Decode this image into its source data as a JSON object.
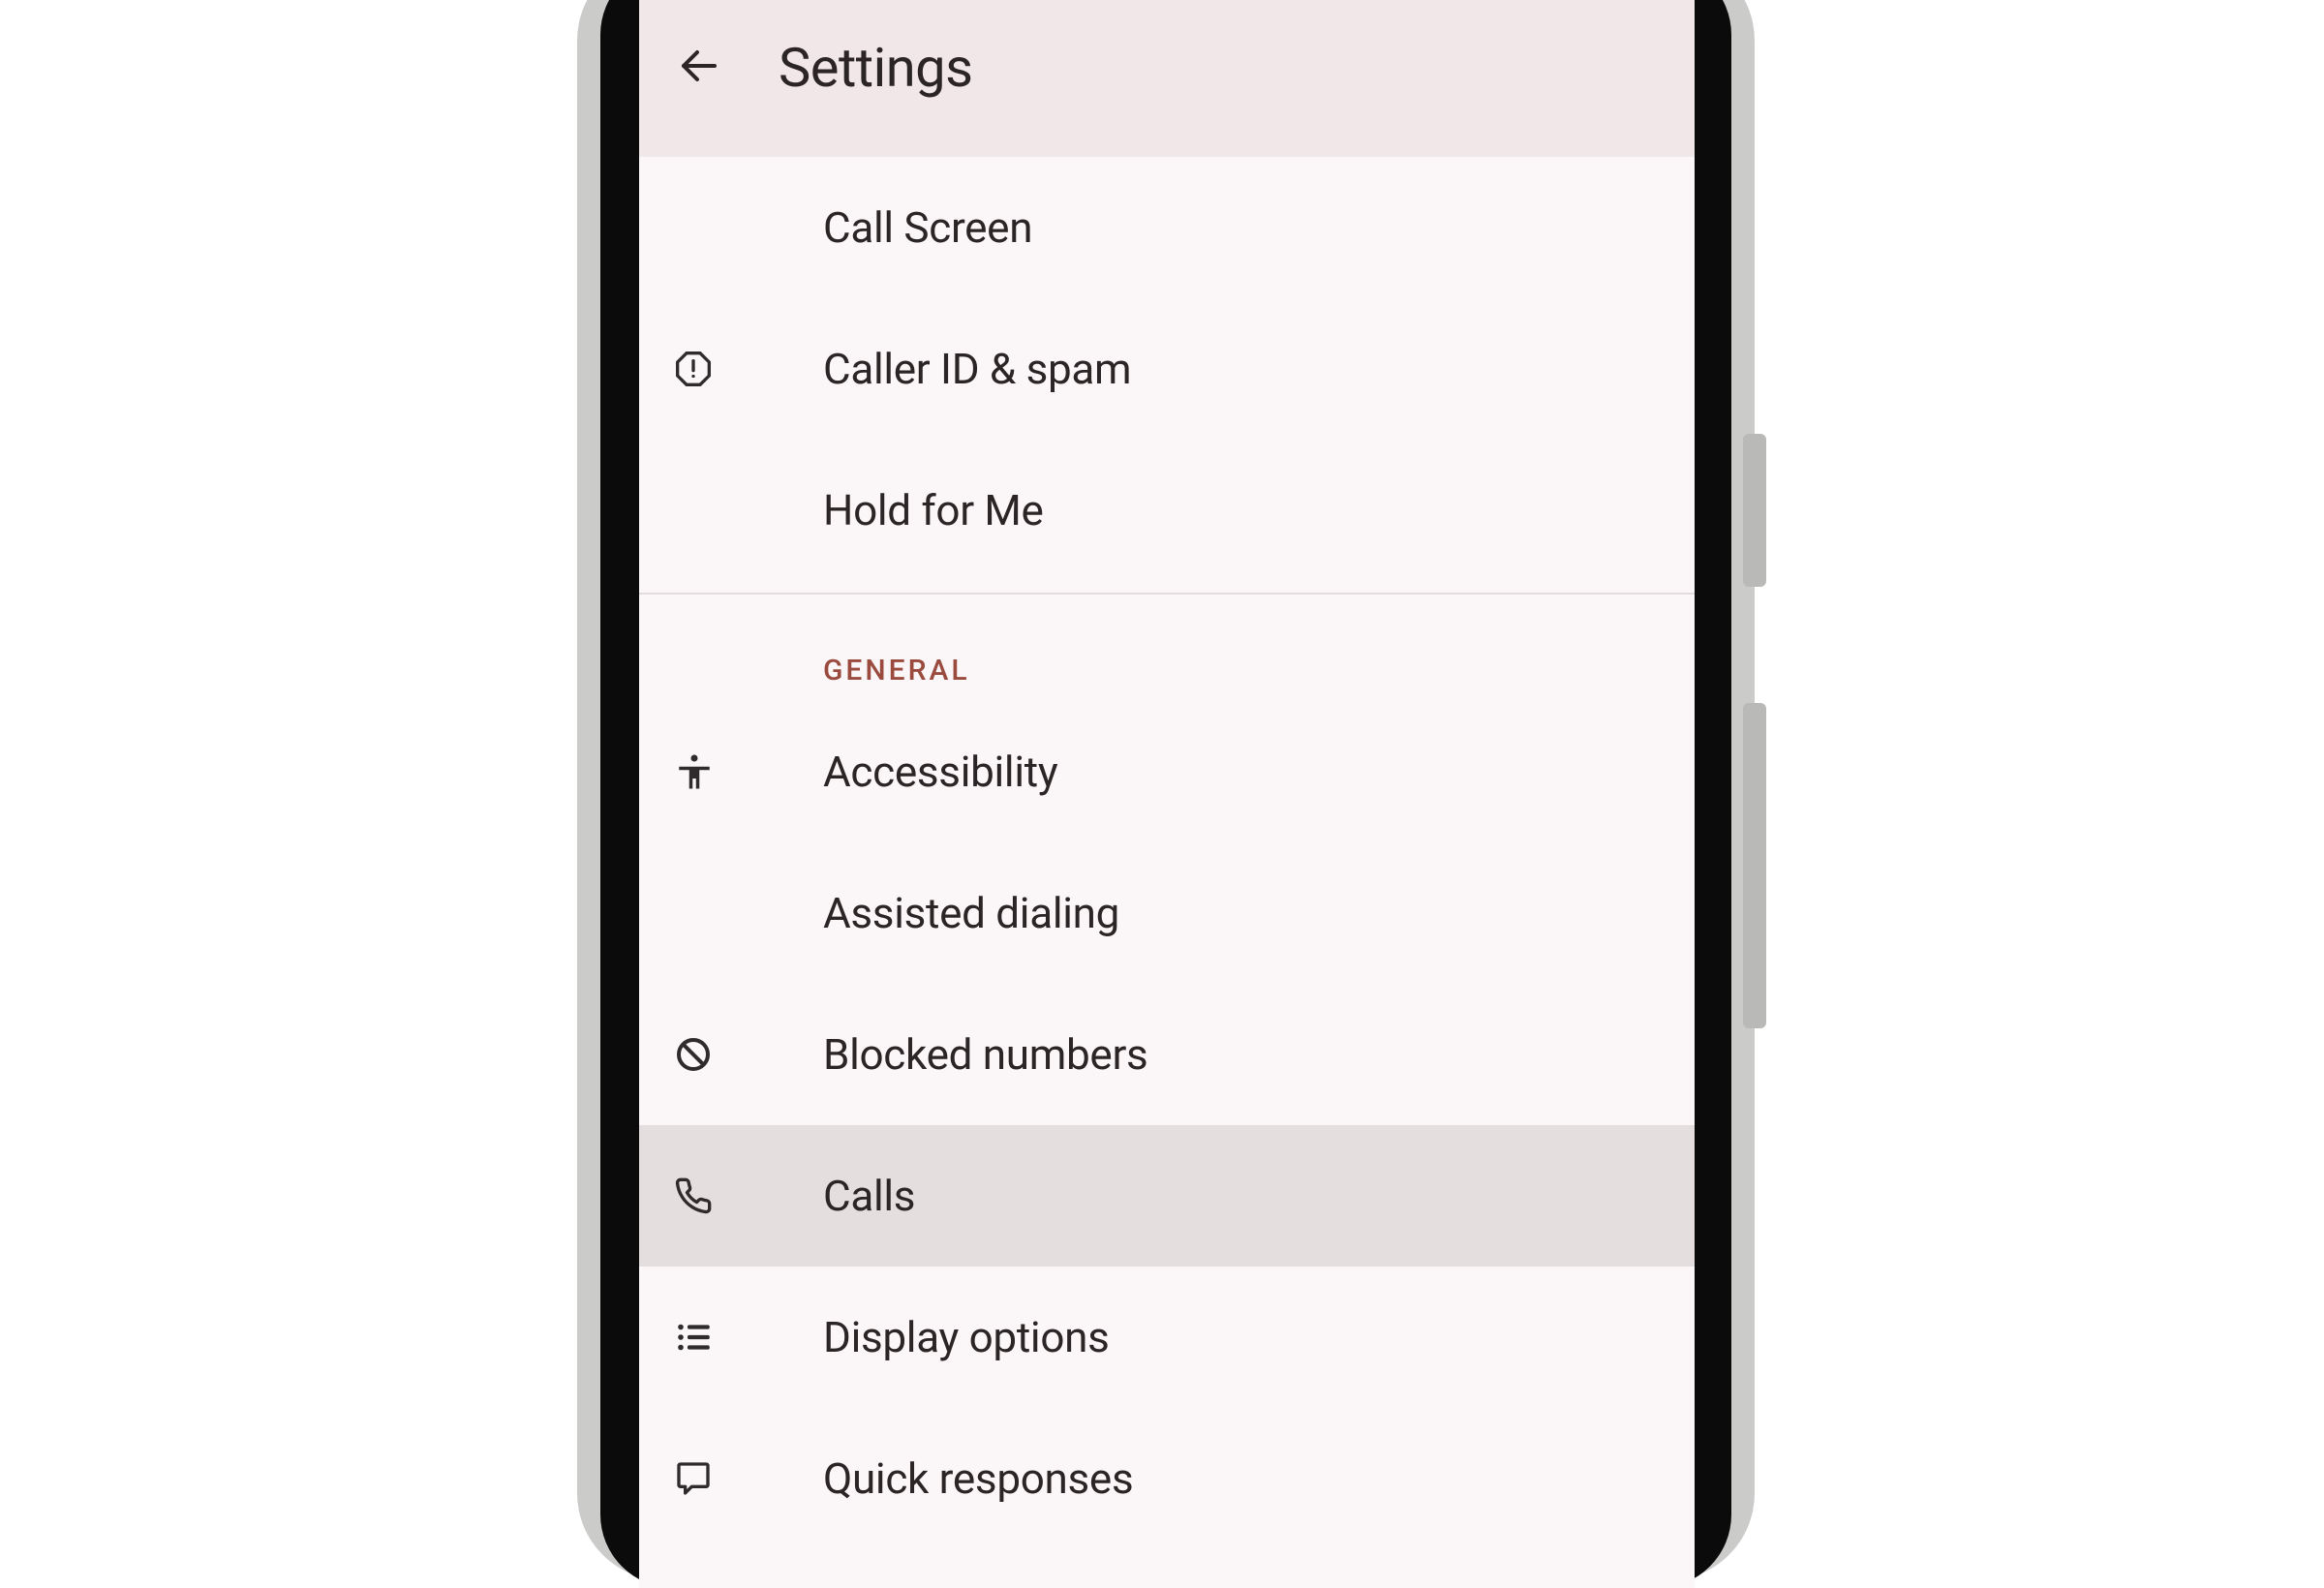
{
  "header": {
    "title": "Settings"
  },
  "top_items": [
    {
      "label": "Call Screen",
      "icon": null
    },
    {
      "label": "Caller ID & spam",
      "icon": "spam-octagon-icon"
    },
    {
      "label": "Hold for Me",
      "icon": null
    }
  ],
  "section": {
    "label": "GENERAL"
  },
  "general_items": [
    {
      "label": "Accessibility",
      "icon": "accessibility-icon",
      "selected": false
    },
    {
      "label": "Assisted dialing",
      "icon": null,
      "selected": false
    },
    {
      "label": "Blocked numbers",
      "icon": "block-icon",
      "selected": false
    },
    {
      "label": "Calls",
      "icon": "phone-icon",
      "selected": true
    },
    {
      "label": "Display options",
      "icon": "list-icon",
      "selected": false
    },
    {
      "label": "Quick responses",
      "icon": "chat-icon",
      "selected": false
    }
  ]
}
